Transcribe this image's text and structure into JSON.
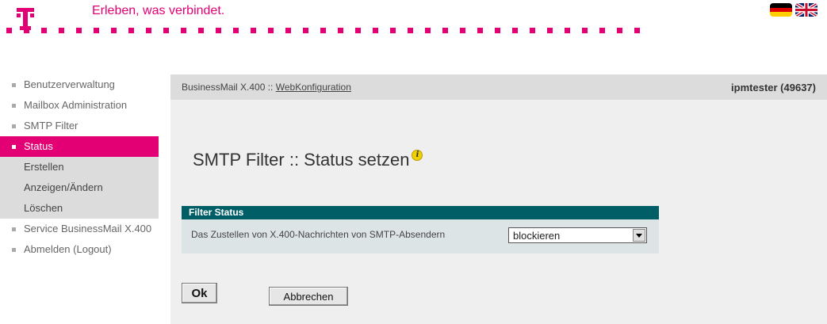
{
  "header": {
    "tagline": "Erleben, was verbindet.",
    "brand_color": "#e20074",
    "flags": [
      {
        "name": "de-flag-icon",
        "label": "Deutsch"
      },
      {
        "name": "uk-flag-icon",
        "label": "English"
      }
    ]
  },
  "sidebar": {
    "items": [
      {
        "label": "Benutzerverwaltung"
      },
      {
        "label": "Mailbox Administration"
      },
      {
        "label": "SMTP Filter"
      },
      {
        "label": "Status",
        "active": true
      },
      {
        "label": "Service BusinessMail X.400"
      },
      {
        "label": "Abmelden (Logout)"
      }
    ],
    "sub_items": [
      {
        "label": "Erstellen"
      },
      {
        "label": "Anzeigen/Ändern"
      },
      {
        "label": "Löschen"
      }
    ]
  },
  "topbar": {
    "crumb_prefix": "BusinessMail X.400 :: ",
    "crumb_link": "WebKonfiguration",
    "user": "ipmtester (49637)"
  },
  "main": {
    "title": "SMTP Filter :: Status setzen",
    "panel": {
      "header": "Filter Status",
      "label": "Das Zustellen von X.400-Nachrichten von SMTP-Absendern",
      "selected": "blockieren"
    },
    "buttons": {
      "ok": "Ok",
      "cancel": "Abbrechen"
    }
  }
}
